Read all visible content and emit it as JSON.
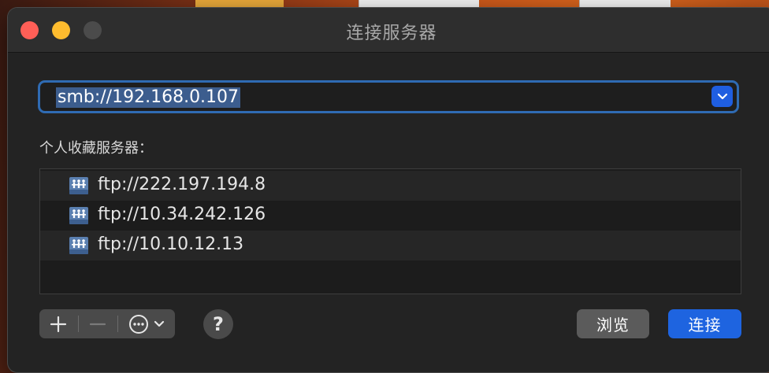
{
  "window": {
    "title": "连接服务器"
  },
  "address": {
    "value": "smb://192.168.0.107"
  },
  "favorites": {
    "label": "个人收藏服务器：",
    "items": [
      {
        "label": "ftp://222.197.194.8"
      },
      {
        "label": "ftp://10.34.242.126"
      },
      {
        "label": "ftp://10.10.12.13"
      }
    ]
  },
  "toolbar": {
    "add_icon": "plus-icon",
    "remove_icon": "minus-icon",
    "more_icon": "ellipsis-circle-icon",
    "help_label": "?",
    "browse_label": "浏览",
    "connect_label": "连接"
  },
  "colors": {
    "accent": "#1e64e0",
    "focus_ring": "#2f6bb3",
    "close": "#ff5f57",
    "minimize": "#febc2e"
  }
}
